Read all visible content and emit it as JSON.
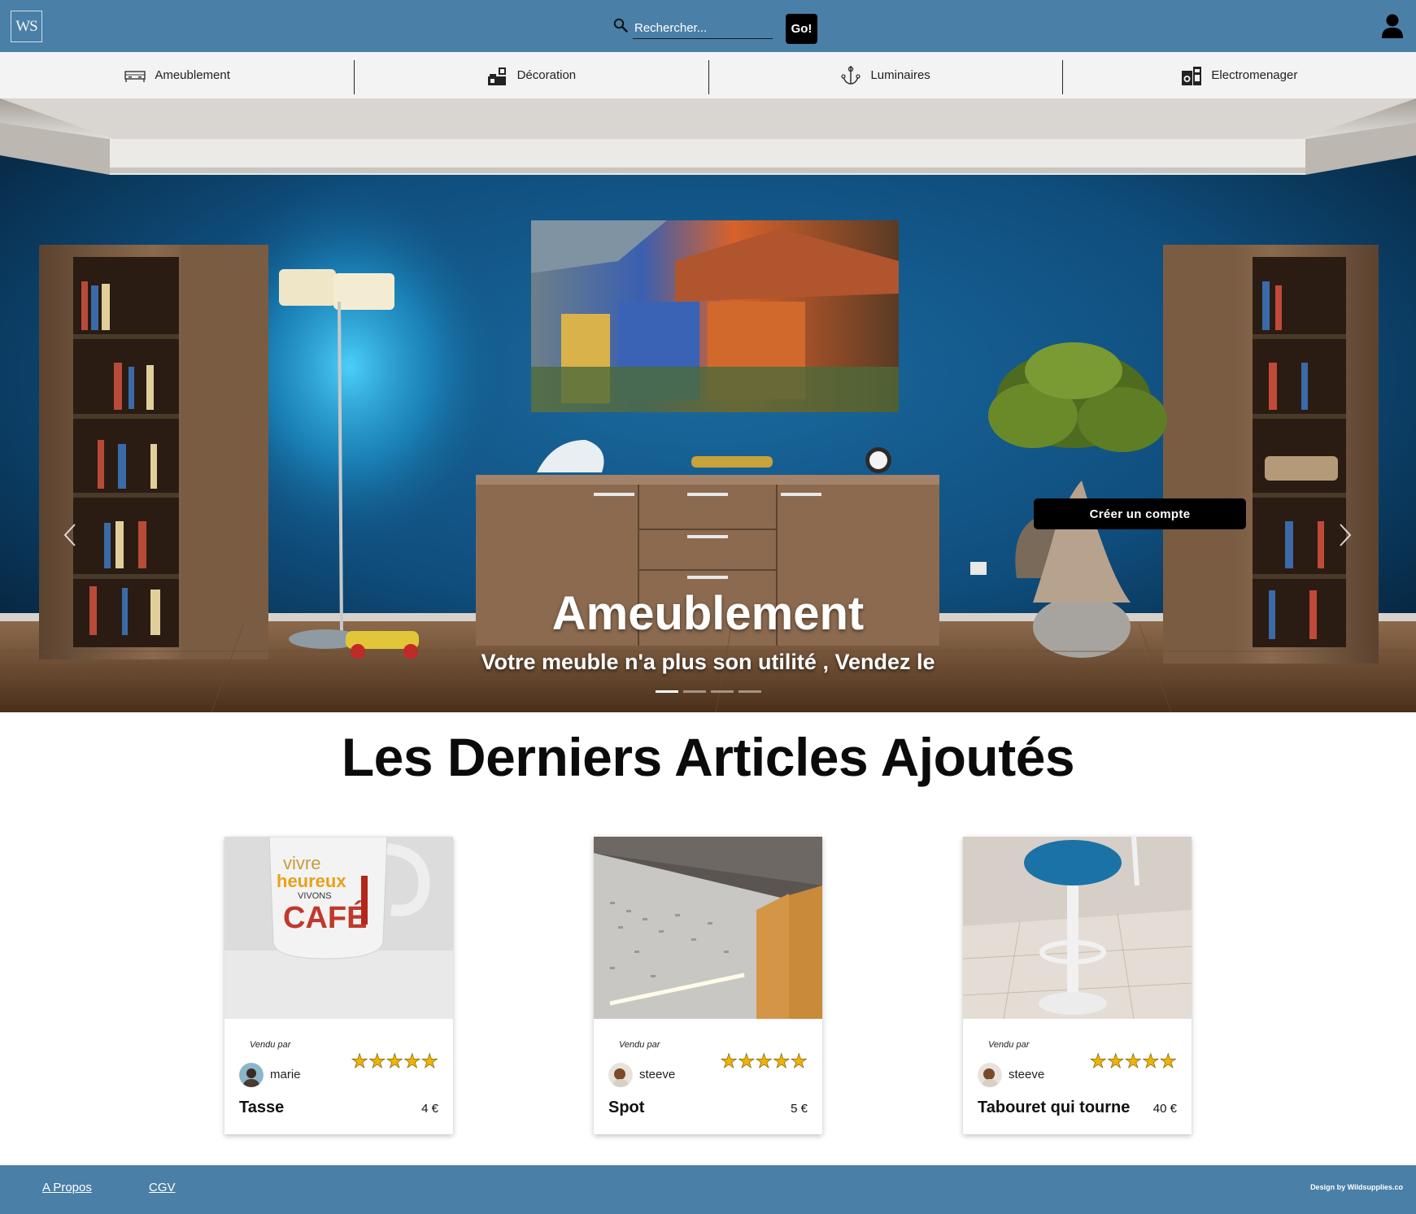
{
  "header": {
    "logo_text": "WS",
    "search_placeholder": "Rechercher...",
    "go_label": "Go!"
  },
  "categories": [
    {
      "label": "Ameublement",
      "icon": "bed-icon"
    },
    {
      "label": "Décoration",
      "icon": "decoration-icon"
    },
    {
      "label": "Luminaires",
      "icon": "lamp-icon"
    },
    {
      "label": "Electromenager",
      "icon": "appliance-icon"
    }
  ],
  "hero": {
    "title": "Ameublement",
    "subtitle": "Votre meuble n'a plus son utilité , Vendez le",
    "cta_label": "Créer un compte",
    "slides": 4,
    "active_slide": 1
  },
  "articles": {
    "heading": "Les Derniers Articles Ajoutés",
    "sold_by_label": "Vendu par",
    "items": [
      {
        "name": "Tasse",
        "price": "4 €",
        "seller": "marie",
        "rating": 5
      },
      {
        "name": "Spot",
        "price": "5 €",
        "seller": "steeve",
        "rating": 5
      },
      {
        "name": "Tabouret qui tourne",
        "price": "40 €",
        "seller": "steeve",
        "rating": 5
      }
    ]
  },
  "footer": {
    "links": [
      "A Propos",
      "CGV"
    ],
    "credit": "Design by Wildsupplies.co"
  },
  "colors": {
    "brand": "#4a7fa7",
    "nav_bg": "#f3f3f3",
    "star": "#f2b200"
  }
}
